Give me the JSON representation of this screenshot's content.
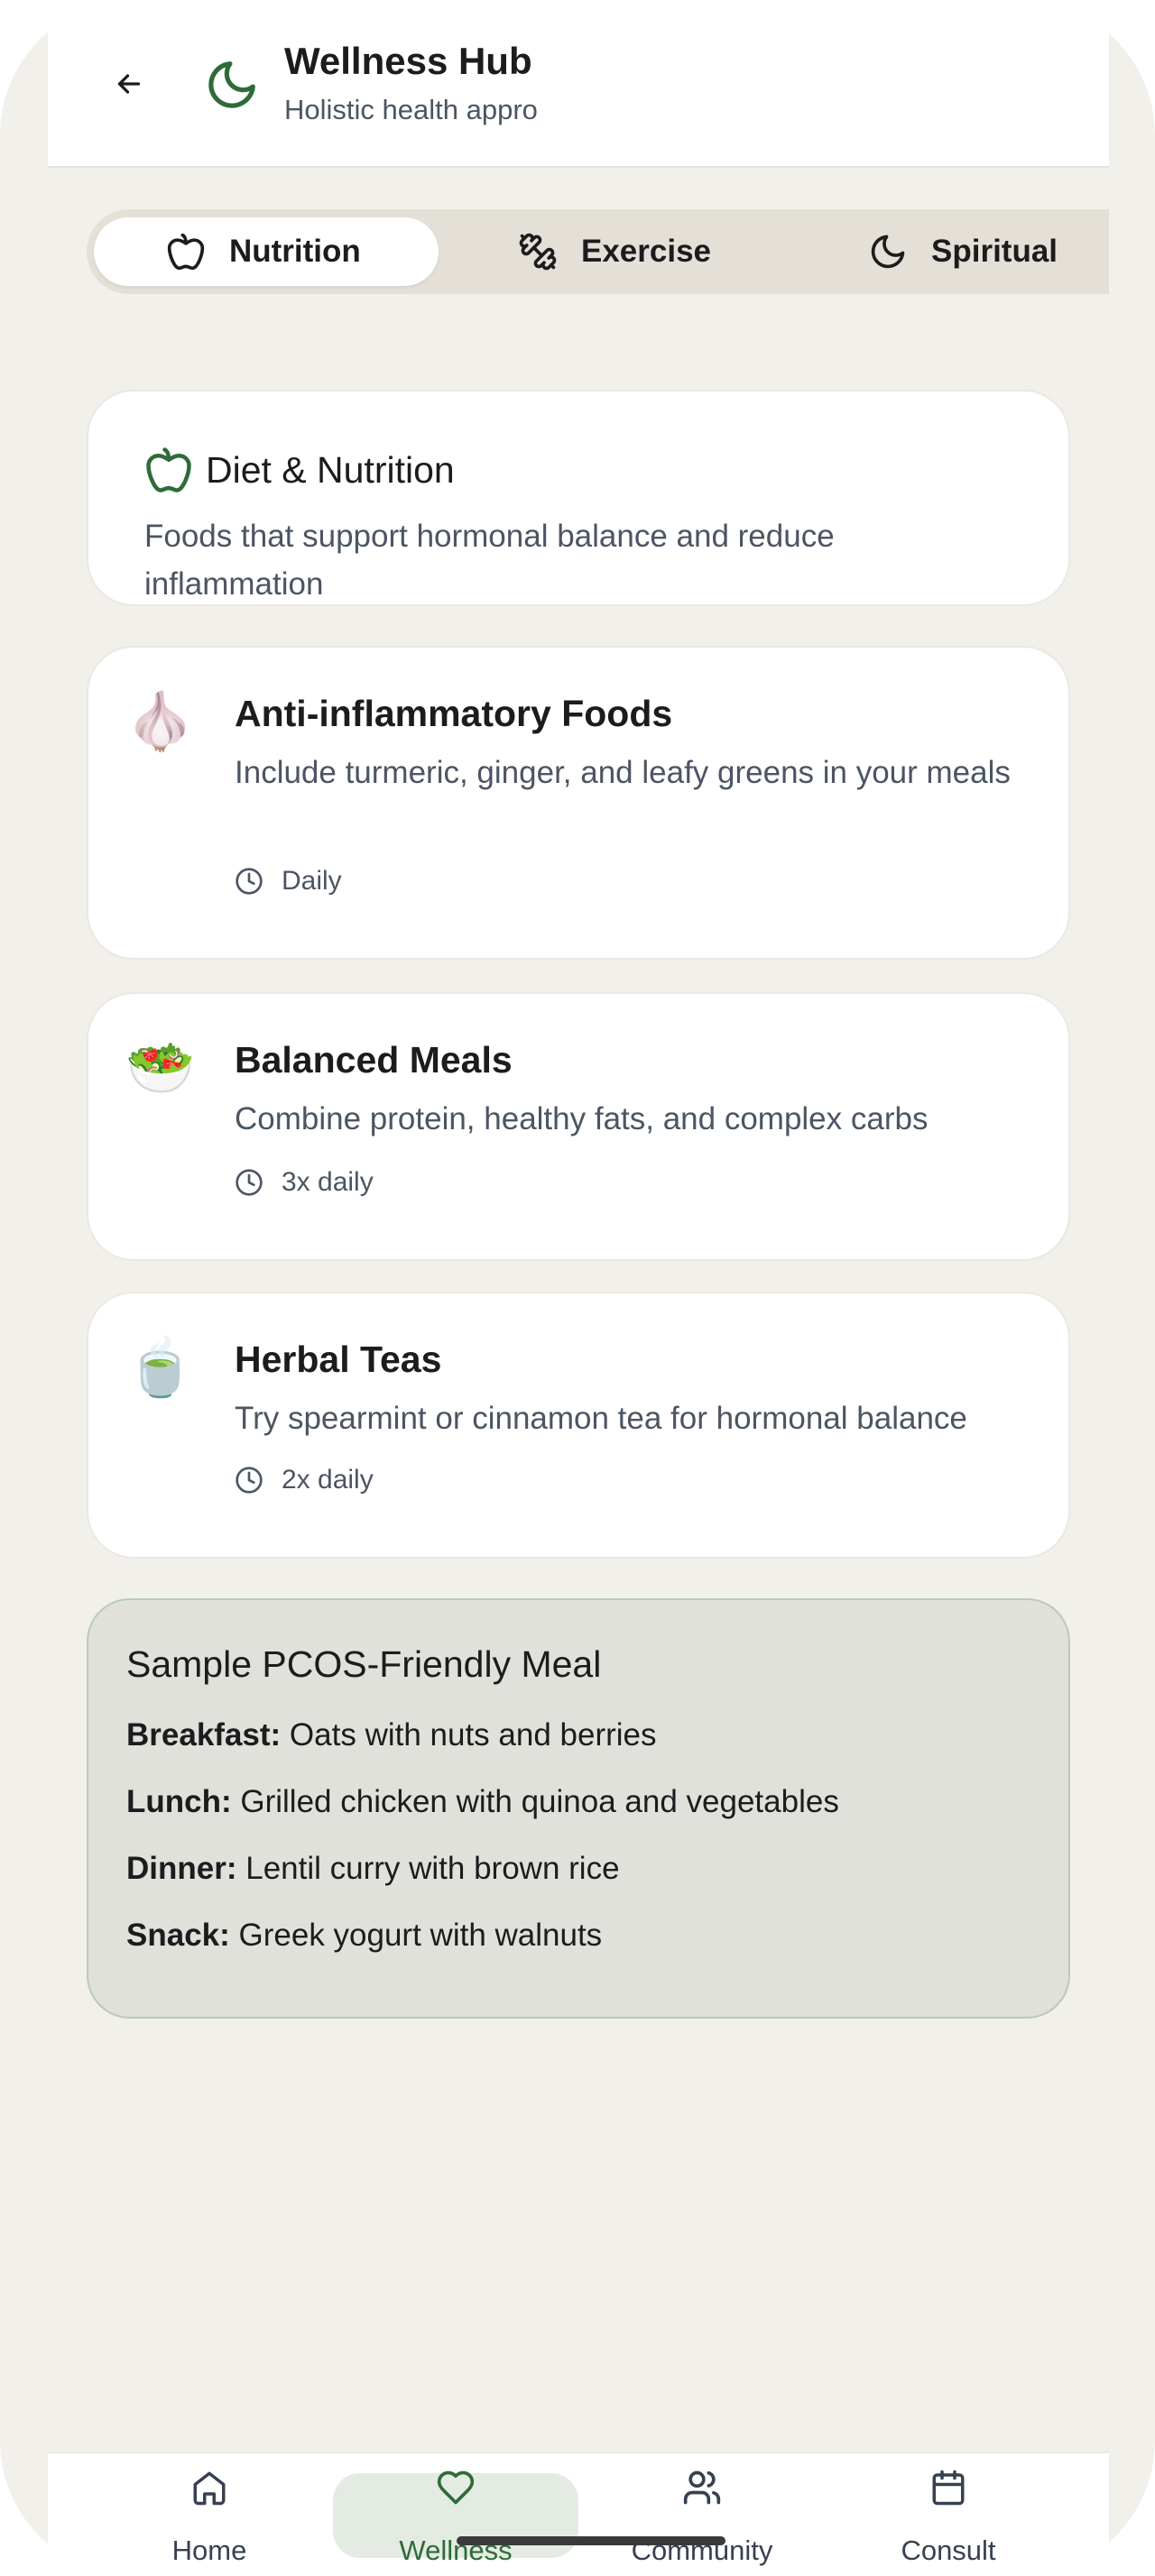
{
  "header": {
    "title": "Wellness Hub",
    "subtitle": "Holistic health appro"
  },
  "tabs": [
    {
      "label": "Nutrition",
      "icon": "apple-icon",
      "active": true
    },
    {
      "label": "Exercise",
      "icon": "dumbbell-icon",
      "active": false
    },
    {
      "label": "Spiritual",
      "icon": "moon-icon",
      "active": false
    }
  ],
  "intro": {
    "title": "Diet & Nutrition",
    "description": "Foods that support hormonal balance and reduce inflammation"
  },
  "tips": [
    {
      "emoji": "🧄",
      "title": "Anti-inflammatory Foods",
      "description": "Include turmeric, ginger, and leafy greens in your meals",
      "frequency": "Daily"
    },
    {
      "emoji": "🥗",
      "title": "Balanced Meals",
      "description": "Combine protein, healthy fats, and complex carbs",
      "frequency": "3x daily"
    },
    {
      "emoji": "🍵",
      "title": "Herbal Teas",
      "description": "Try spearmint or cinnamon tea for hormonal balance",
      "frequency": "2x daily"
    }
  ],
  "sample_meal": {
    "title": "Sample PCOS-Friendly Meal",
    "rows": [
      {
        "label": "Breakfast:",
        "value": " Oats with nuts and berries"
      },
      {
        "label": "Lunch:",
        "value": " Grilled chicken with quinoa and vegetables"
      },
      {
        "label": "Dinner:",
        "value": " Lentil curry with brown rice"
      },
      {
        "label": "Snack:",
        "value": " Greek yogurt with walnuts"
      }
    ]
  },
  "nav": [
    {
      "label": "Home",
      "icon": "home-icon",
      "active": false
    },
    {
      "label": "Wellness",
      "icon": "heart-icon",
      "active": true
    },
    {
      "label": "Community",
      "icon": "users-icon",
      "active": false
    },
    {
      "label": "Consult",
      "icon": "calendar-icon",
      "active": false
    }
  ],
  "colors": {
    "accent_green": "#2f6b3a",
    "background": "#f2f0ea",
    "meal_card_bg": "#dfe1da"
  }
}
